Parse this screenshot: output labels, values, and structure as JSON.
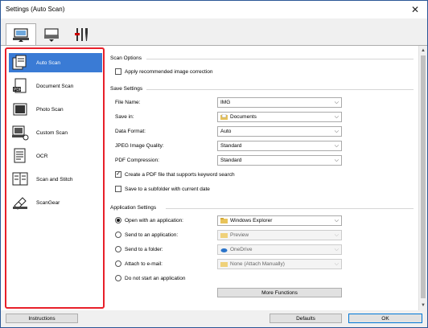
{
  "window": {
    "title": "Settings (Auto Scan)"
  },
  "tabs": [
    {
      "icon": "scan-from-computer-icon"
    },
    {
      "icon": "scan-from-operation-panel-icon"
    },
    {
      "icon": "general-settings-icon"
    }
  ],
  "sidebar": {
    "items": [
      {
        "label": "Auto Scan",
        "icon": "auto-scan-icon",
        "selected": true
      },
      {
        "label": "Document Scan",
        "icon": "document-scan-icon"
      },
      {
        "label": "Photo Scan",
        "icon": "photo-scan-icon"
      },
      {
        "label": "Custom Scan",
        "icon": "custom-scan-icon"
      },
      {
        "label": "OCR",
        "icon": "ocr-icon"
      },
      {
        "label": "Scan and Stitch",
        "icon": "scan-and-stitch-icon"
      },
      {
        "label": "ScanGear",
        "icon": "scangear-icon"
      }
    ]
  },
  "scan_options": {
    "heading": "Scan Options",
    "apply_correction": {
      "label": "Apply recommended image correction",
      "checked": false
    }
  },
  "save_settings": {
    "heading": "Save Settings",
    "file_name": {
      "label": "File Name:",
      "value": "IMG"
    },
    "save_in": {
      "label": "Save in:",
      "value": "Documents"
    },
    "data_format": {
      "label": "Data Format:",
      "value": "Auto"
    },
    "jpeg_quality": {
      "label": "JPEG Image Quality:",
      "value": "Standard"
    },
    "pdf_compression": {
      "label": "PDF Compression:",
      "value": "Standard"
    },
    "keyword_pdf": {
      "label": "Create a PDF file that supports keyword search",
      "checked": true
    },
    "subfolder": {
      "label": "Save to a subfolder with current date",
      "checked": false
    }
  },
  "application_settings": {
    "heading": "Application Settings",
    "open_app": {
      "label": "Open with an application:",
      "value": "Windows Explorer",
      "selected": true
    },
    "send_app": {
      "label": "Send to an application:",
      "value": "Preview",
      "selected": false
    },
    "send_folder": {
      "label": "Send to a folder:",
      "value": "OneDrive",
      "selected": false
    },
    "attach_email": {
      "label": "Attach to e-mail:",
      "value": "None (Attach Manually)",
      "selected": false
    },
    "no_app": {
      "label": "Do not start an application",
      "selected": false
    },
    "more_functions": "More Functions"
  },
  "footer": {
    "instructions": "Instructions",
    "defaults": "Defaults",
    "ok": "OK"
  },
  "colors": {
    "accent": "#3a7bd5",
    "highlight_border": "#e8202a",
    "window_border": "#2b5797"
  }
}
